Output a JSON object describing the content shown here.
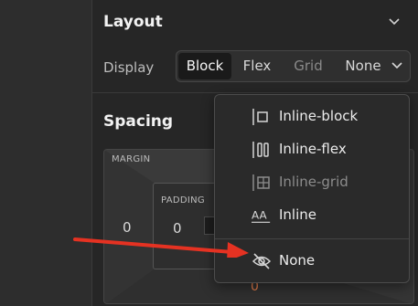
{
  "layout": {
    "section_title": "Layout",
    "display_label": "Display",
    "display_options": [
      "Block",
      "Flex",
      "Grid",
      "None"
    ],
    "selected_display": "Block",
    "dropdown_value": "None"
  },
  "spacing": {
    "section_title": "Spacing",
    "margin_label": "MARGIN",
    "padding_label": "PADDING",
    "margin_left": "0",
    "padding_left": "0",
    "margin_bottom": "0"
  },
  "dropdown_menu": {
    "items": [
      {
        "label": "Inline-block",
        "icon": "inline-block-icon",
        "disabled": false
      },
      {
        "label": "Inline-flex",
        "icon": "inline-flex-icon",
        "disabled": false
      },
      {
        "label": "Inline-grid",
        "icon": "inline-grid-icon",
        "disabled": true
      },
      {
        "label": "Inline",
        "icon": "inline-text-icon",
        "disabled": false
      },
      {
        "label": "None",
        "icon": "eye-slash-icon",
        "disabled": false
      }
    ]
  },
  "colors": {
    "panel_bg": "#262626",
    "menu_bg": "#2a2a2a",
    "arrow": "#e53222",
    "margin_value_accent": "#e07b4a"
  }
}
